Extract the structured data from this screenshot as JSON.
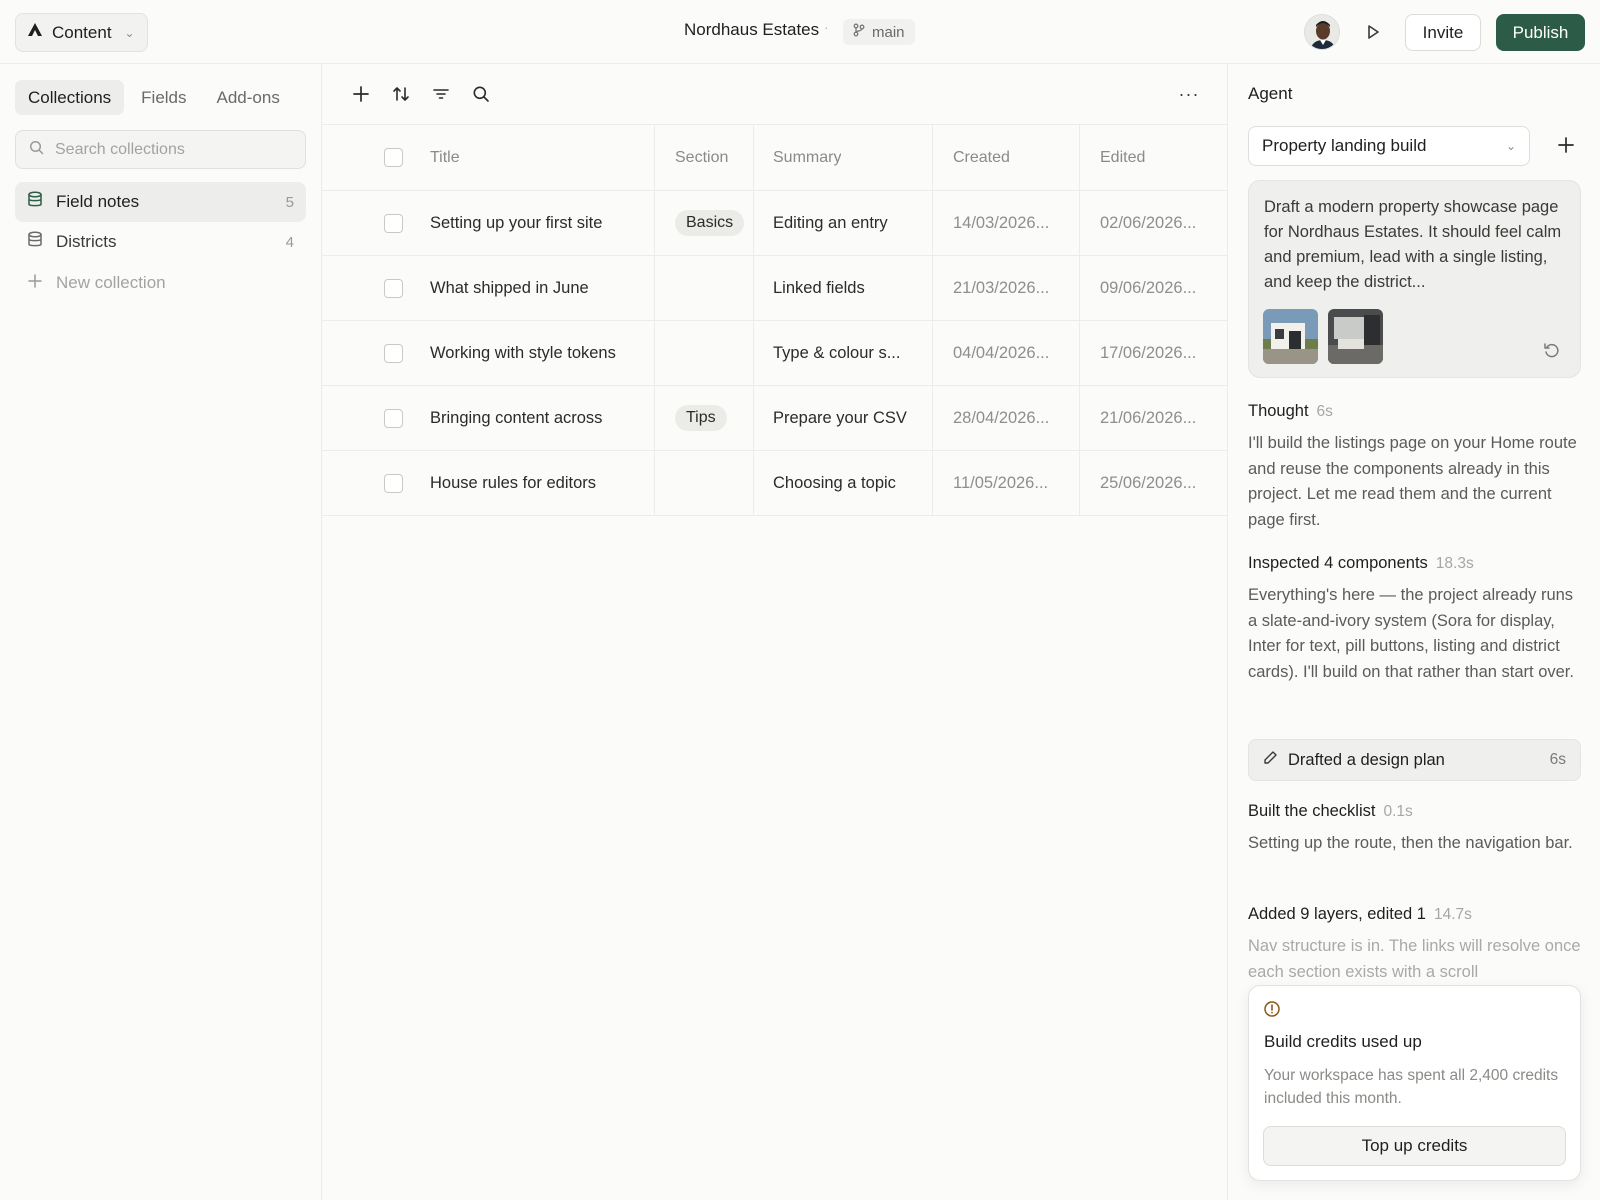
{
  "header": {
    "workspace_label": "Content",
    "project_title": "Nordhaus Estates",
    "separator": "·",
    "branch": "main",
    "invite_label": "Invite",
    "publish_label": "Publish",
    "colors": {
      "publish_bg": "#2c5c47"
    }
  },
  "sidebar": {
    "tabs": [
      {
        "label": "Collections",
        "active": true
      },
      {
        "label": "Fields",
        "active": false
      },
      {
        "label": "Add-ons",
        "active": false
      }
    ],
    "search_placeholder": "Search collections",
    "collections": [
      {
        "label": "Field notes",
        "count": "5",
        "icon": "database-icon",
        "active": true
      },
      {
        "label": "Districts",
        "count": "4",
        "icon": "database-icon",
        "active": false
      }
    ],
    "new_collection_label": "New collection"
  },
  "table": {
    "toolbar_icons": [
      "plus-icon",
      "sort-icon",
      "filter-icon",
      "search-icon",
      "more-icon"
    ],
    "more_label": "···",
    "columns": [
      "Title",
      "Section",
      "Summary",
      "Created",
      "Edited"
    ],
    "rows": [
      {
        "title": "Setting up your first site",
        "section": "Basics",
        "summary": "Editing an entry",
        "created": "14/03/2026...",
        "edited": "02/06/2026..."
      },
      {
        "title": "What shipped in June",
        "section": "",
        "summary": "Linked fields",
        "created": "21/03/2026...",
        "edited": "09/06/2026..."
      },
      {
        "title": "Working with style tokens",
        "section": "",
        "summary": "Type & colour s...",
        "created": "04/04/2026...",
        "edited": "17/06/2026..."
      },
      {
        "title": "Bringing content across",
        "section": "Tips",
        "summary": "Prepare your CSV",
        "created": "28/04/2026...",
        "edited": "21/06/2026..."
      },
      {
        "title": "House rules for editors",
        "section": "",
        "summary": "Choosing a topic",
        "created": "11/05/2026...",
        "edited": "25/06/2026..."
      }
    ]
  },
  "agent": {
    "title": "Agent",
    "selected_session": "Property landing build",
    "prompt": "Draft a modern property showcase page for Nordhaus Estates. It should feel calm and premium, lead with a single listing, and keep the district...",
    "steps": [
      {
        "head": "Thought",
        "time": "6s",
        "body": "I'll build the listings page on your Home route and reuse the components already in this project. Let me read them and the current page first."
      },
      {
        "head": "Inspected 4 components",
        "time": "18.3s",
        "body": "Everything's here — the project already runs a slate-and-ivory system (Sora for display, Inter for text, pill buttons, listing and district cards). I'll build on that rather than start over."
      },
      {
        "head": "Built the checklist",
        "time": "0.1s",
        "body": "Setting up the route, then the navigation bar."
      },
      {
        "head": "Added 9 layers, edited 1",
        "time": "14.7s",
        "body": "Nav structure is in. The links will resolve once each section exists with a scroll"
      }
    ],
    "plan": {
      "label": "Drafted a design plan",
      "time": "6s"
    },
    "credits": {
      "title": "Build credits used up",
      "text": "Your workspace has spent all 2,400 credits included this month.",
      "button": "Top up credits"
    }
  }
}
